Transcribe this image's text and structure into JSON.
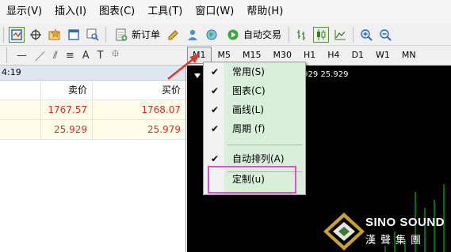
{
  "menubar": {
    "items": [
      "显示(V)",
      "插入(I)",
      "图表(C)",
      "工具(T)",
      "窗口(W)",
      "帮助(H)"
    ]
  },
  "toolbar": {
    "new_order_label": "新订单",
    "auto_trade_label": "自动交易",
    "icons": [
      "profile-icon",
      "crosshair-icon",
      "favorites-icon",
      "window-icon",
      "zoom-chart-icon",
      "new-order-icon",
      "pencil-icon",
      "user-icon",
      "globe-icon",
      "auto-trade-icon",
      "bar-chart-icon",
      "candle-chart-icon",
      "line-chart-icon",
      "zoom-in-icon",
      "zoom-out-icon"
    ]
  },
  "draw_tools": {
    "items": [
      "—",
      "／",
      "⫽",
      "≡",
      "A",
      "T",
      "⯐"
    ]
  },
  "timeframes": [
    "M1",
    "M5",
    "M15",
    "M30",
    "H1",
    "H4",
    "D1",
    "W1",
    "MN"
  ],
  "left_panel": {
    "header_time": "4:19",
    "columns": [
      "",
      "卖价",
      "买价"
    ],
    "rows": [
      {
        "bid": "1767.57",
        "ask": "1768.07"
      },
      {
        "bid": "25.929",
        "ask": "25.979"
      }
    ]
  },
  "chart": {
    "info_text": ".929 25.929"
  },
  "dropdown": {
    "items": [
      {
        "label": "常用(S)",
        "checked": true
      },
      {
        "label": "图表(C)",
        "checked": true
      },
      {
        "label": "画线(L)",
        "checked": true
      },
      {
        "label": "周期 (f)",
        "checked": true
      },
      {
        "label": "自动排列(A)",
        "checked": true
      },
      {
        "label": "定制(u)",
        "checked": false
      }
    ]
  },
  "logo": {
    "brand": "SINO SOUND",
    "chinese": "漢聲集團"
  },
  "colors": {
    "highlight": "#e04fd6",
    "arrow": "#e8322a",
    "price": "#d32f2f",
    "menu_strip": "#d9efd9"
  }
}
